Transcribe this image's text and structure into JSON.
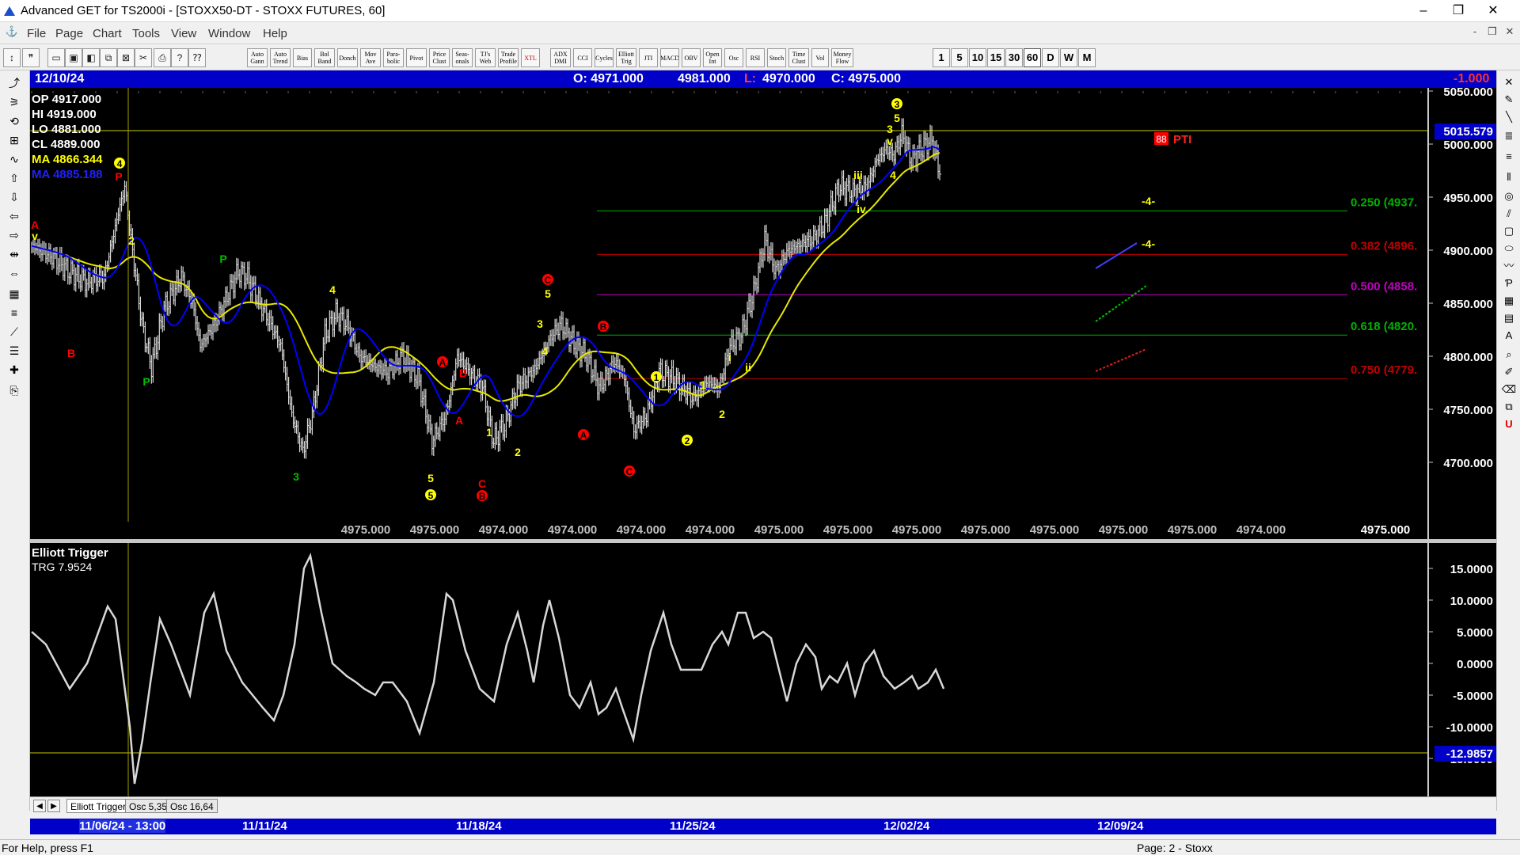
{
  "window": {
    "title": "Advanced GET for TS2000i - [STOXX50-DT - STOXX FUTURES, 60]",
    "controls": [
      "–",
      "❐",
      "✕"
    ]
  },
  "menu": {
    "items": [
      "File",
      "Page",
      "Chart",
      "Tools",
      "View",
      "Window",
      "Help"
    ],
    "mdi_controls": [
      "-",
      "❐",
      "✕"
    ]
  },
  "toolbar": {
    "icons": [
      "new-icon",
      "open-icon",
      "save-icon",
      "copy-icon",
      "paste-icon",
      "cut-icon",
      "print-icon",
      "help-icon",
      "lock-icon"
    ],
    "studies": [
      "Auto Gann",
      "Auto Trend",
      "Bias",
      "Bol Band",
      "Donch",
      "Mov Ave",
      "Para-bolic",
      "Pivot",
      "Price Clust",
      "Seas-onals",
      "TJ's Web",
      "Trade Profile",
      "XTL",
      "ADX DMI",
      "CCI",
      "Cycles",
      "Elliott Trig",
      "JTI",
      "MACD",
      "OBV",
      "Open Int",
      "Osc",
      "RSI",
      "Stoch",
      "Time Clust",
      "Vol",
      "Money Flow"
    ],
    "periods": [
      "1",
      "5",
      "10",
      "15",
      "30",
      "60",
      "D",
      "W",
      "M"
    ],
    "active_period": "60"
  },
  "infobar": {
    "date": "12/10/24",
    "open": "O: 4971.000",
    "high": "4981.000",
    "low_label": "L:",
    "low_value": "4970.000",
    "close": "C: 4975.000",
    "change": "-1.000"
  },
  "ohlc_box": {
    "op": "OP  4917.000",
    "hi": "HI   4919.000",
    "lo": "LO  4881.000",
    "cl": "CL  4889.000",
    "ma1": "MA  4866.344",
    "ma2": "MA  4885.188"
  },
  "price_chart": {
    "ymin": 4650,
    "ymax": 5050,
    "ticks": [
      "4700.000",
      "4750.000",
      "4800.000",
      "4850.000",
      "4900.000",
      "4950.000",
      "5000.000",
      "5050.000"
    ],
    "current_price": "5015.579",
    "current_value": 5015.579,
    "bottom_labels": [
      "4975.000",
      "4975.000",
      "4974.000",
      "4974.000",
      "4974.000",
      "4974.000",
      "4975.000",
      "4975.000",
      "4975.000",
      "4975.000",
      "4975.000",
      "4975.000",
      "4975.000",
      "4974.000"
    ],
    "bottom_last": "4975.000",
    "fib_levels": [
      {
        "label": "0.250 (4937.",
        "value": 4937,
        "color": "#00b000"
      },
      {
        "label": "0.382 (4896.",
        "value": 4896,
        "color": "#c00000"
      },
      {
        "label": "0.500 (4858.",
        "value": 4858,
        "color": "#c000c0"
      },
      {
        "label": "0.618 (4820.",
        "value": 4820,
        "color": "#00b000"
      },
      {
        "label": "0.750 (4779.",
        "value": 4779,
        "color": "#c00000"
      }
    ],
    "pti_badge": "88",
    "pti_label": "PTI",
    "target_label": "-4-"
  },
  "oscillator": {
    "name": "Elliott Trigger",
    "value_label": "TRG 7.9524",
    "ymin": -20,
    "ymax": 18,
    "ticks": [
      "15.0000",
      "10.0000",
      "5.0000",
      "0.0000",
      "-5.0000",
      "-10.0000",
      "-15.0000"
    ],
    "current": "-12.9857",
    "current_value": -12.9857,
    "tabs": [
      "Elliott Trigger",
      "Osc 5,35",
      "Osc 16,64"
    ]
  },
  "time_axis": {
    "labels": [
      "11/06/24 - 13:00",
      "11/11/24",
      "11/18/24",
      "11/25/24",
      "12/02/24",
      "12/09/24"
    ]
  },
  "statusbar": {
    "help": "For Help, press F1",
    "page": "Page: 2 - Stoxx"
  },
  "colors": {
    "infobar_bg": "#0000c8",
    "chart_bg": "#000000",
    "wave_yellow": "#ffff00",
    "wave_red": "#ff0000",
    "wave_green": "#00c000",
    "ma_fast": "#0000ff",
    "ma_slow": "#e8e800"
  }
}
